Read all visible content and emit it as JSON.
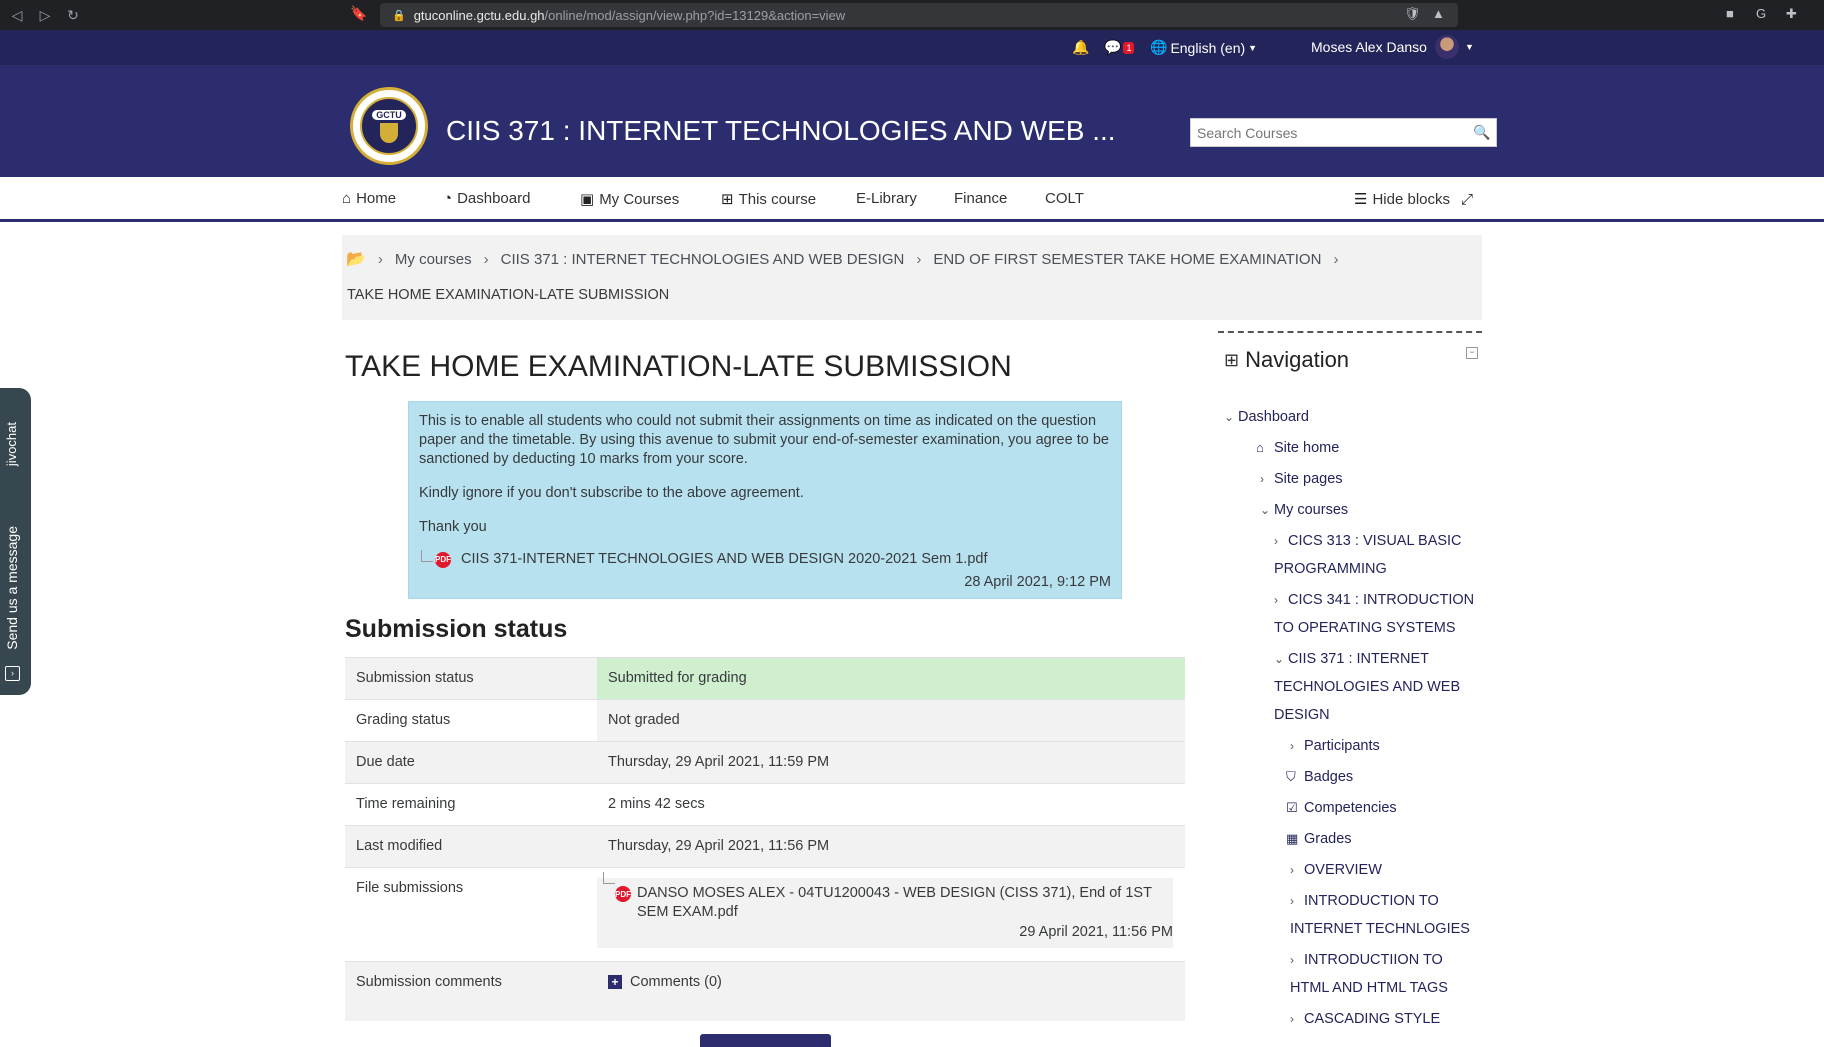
{
  "browser": {
    "url_host": "gtuconline.gctu.edu.gh",
    "url_path": "/online/mod/assign/view.php?id=13129&action=view"
  },
  "userbar": {
    "messages_count": "1",
    "language": "English (en)",
    "user_name": "Moses Alex Danso"
  },
  "header": {
    "logo_text": "GCTU",
    "course_title": "CIIS 371 : INTERNET TECHNOLOGIES AND WEB ...",
    "search_placeholder": "Search Courses"
  },
  "mainnav": {
    "home": "Home",
    "dashboard": "Dashboard",
    "my_courses": "My Courses",
    "this_course": "This course",
    "elibrary": "E-Library",
    "finance": "Finance",
    "colt": "COLT",
    "hide_blocks": "Hide blocks"
  },
  "breadcrumb": {
    "items": [
      "My courses",
      "CIIS 371 : INTERNET TECHNOLOGIES AND WEB DESIGN",
      "END OF FIRST SEMESTER TAKE HOME EXAMINATION"
    ],
    "current": "TAKE HOME EXAMINATION-LATE SUBMISSION"
  },
  "page": {
    "title": "TAKE HOME EXAMINATION-LATE SUBMISSION",
    "intro": {
      "paragraph1": "This is to enable all students who could not submit their assignments on time as indicated on the question paper and the timetable. By using this avenue to submit your end-of-semester examination, you agree to be sanctioned by deducting 10 marks from your score.",
      "paragraph2": "Kindly ignore if you don't subscribe to the above agreement.",
      "paragraph3": "Thank you",
      "file_name": "CIIS 371-INTERNET TECHNOLOGIES AND WEB DESIGN 2020-2021 Sem 1.pdf",
      "file_date": "28 April 2021, 9:12 PM"
    }
  },
  "submission": {
    "heading": "Submission status",
    "rows": [
      {
        "label": "Submission status",
        "value": "Submitted for grading"
      },
      {
        "label": "Grading status",
        "value": "Not graded"
      },
      {
        "label": "Due date",
        "value": "Thursday, 29 April 2021, 11:59 PM"
      },
      {
        "label": "Time remaining",
        "value": "2 mins 42 secs"
      },
      {
        "label": "Last modified",
        "value": "Thursday, 29 April 2021, 11:56 PM"
      }
    ],
    "file_label": "File submissions",
    "file_name": "DANSO MOSES ALEX - 04TU1200043 - WEB DESIGN (CISS 371), End of 1ST SEM EXAM.pdf",
    "file_date": "29 April 2021, 11:56 PM",
    "comments_label": "Submission comments",
    "comments_link": "Comments (0)"
  },
  "navigation": {
    "title": "Navigation",
    "items": {
      "dashboard": "Dashboard",
      "site_home": "Site home",
      "site_pages": "Site pages",
      "my_courses": "My courses",
      "cics313_a": "CICS 313 : VISUAL BASIC",
      "cics313_b": "PROGRAMMING",
      "cics341_a": "CICS 341 : INTRODUCTION",
      "cics341_b": "TO OPERATING SYSTEMS",
      "ciis371_a": "CIIS 371 : INTERNET",
      "ciis371_b": "TECHNOLOGIES AND WEB",
      "ciis371_c": "DESIGN",
      "participants": "Participants",
      "badges": "Badges",
      "competencies": "Competencies",
      "grades": "Grades",
      "overview": "OVERVIEW",
      "intro_internet_a": "INTRODUCTION TO",
      "intro_internet_b": "INTERNET TECHNLOGIES",
      "intro_html_a": "INTRODUCTIION TO",
      "intro_html_b": "HTML AND HTML TAGS",
      "css": "CASCADING STYLE"
    }
  },
  "jivochat": {
    "brand": "jivochat",
    "label": "Send us a message"
  },
  "colors": {
    "header_bg": "#2b2d6e",
    "userbar_bg": "#23245a",
    "intro_bg": "#b8e1ef",
    "submitted_bg": "#cfefcf"
  }
}
